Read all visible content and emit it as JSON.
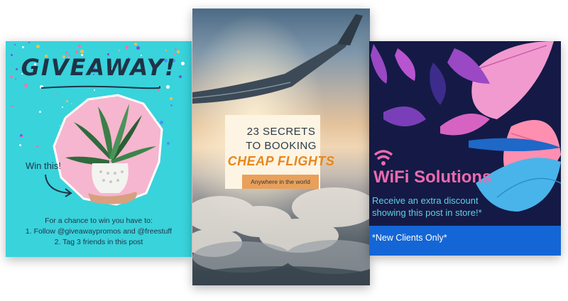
{
  "giveaway": {
    "title": "GIVEAWAY!",
    "win_label": "Win this!",
    "lines": [
      "For a chance to win you have to:",
      "1. Follow @giveawaypromos and @freestuff",
      "2. Tag 3 friends in this post"
    ],
    "colors": {
      "background": "#39d3dc",
      "text": "#1f3346",
      "paper": "#f6b6cf"
    }
  },
  "flights": {
    "line1": "23 SECRETS",
    "line2": "TO BOOKING",
    "line3": "CHEAP FLIGHTS",
    "tag": "Anywhere in the world",
    "colors": {
      "accent": "#e9861a",
      "box": "#fdf4e3",
      "tag": "#e9a05a"
    }
  },
  "wifi": {
    "icon": "wifi-icon",
    "title": "WiFi Solutions",
    "desc_lines": [
      "Receive an extra discount",
      "showing this post in store!*"
    ],
    "footer": "*New Clients Only*",
    "colors": {
      "background": "#141a45",
      "title": "#ee6ab0",
      "desc": "#62cde6",
      "footer": "#1466d6"
    }
  }
}
